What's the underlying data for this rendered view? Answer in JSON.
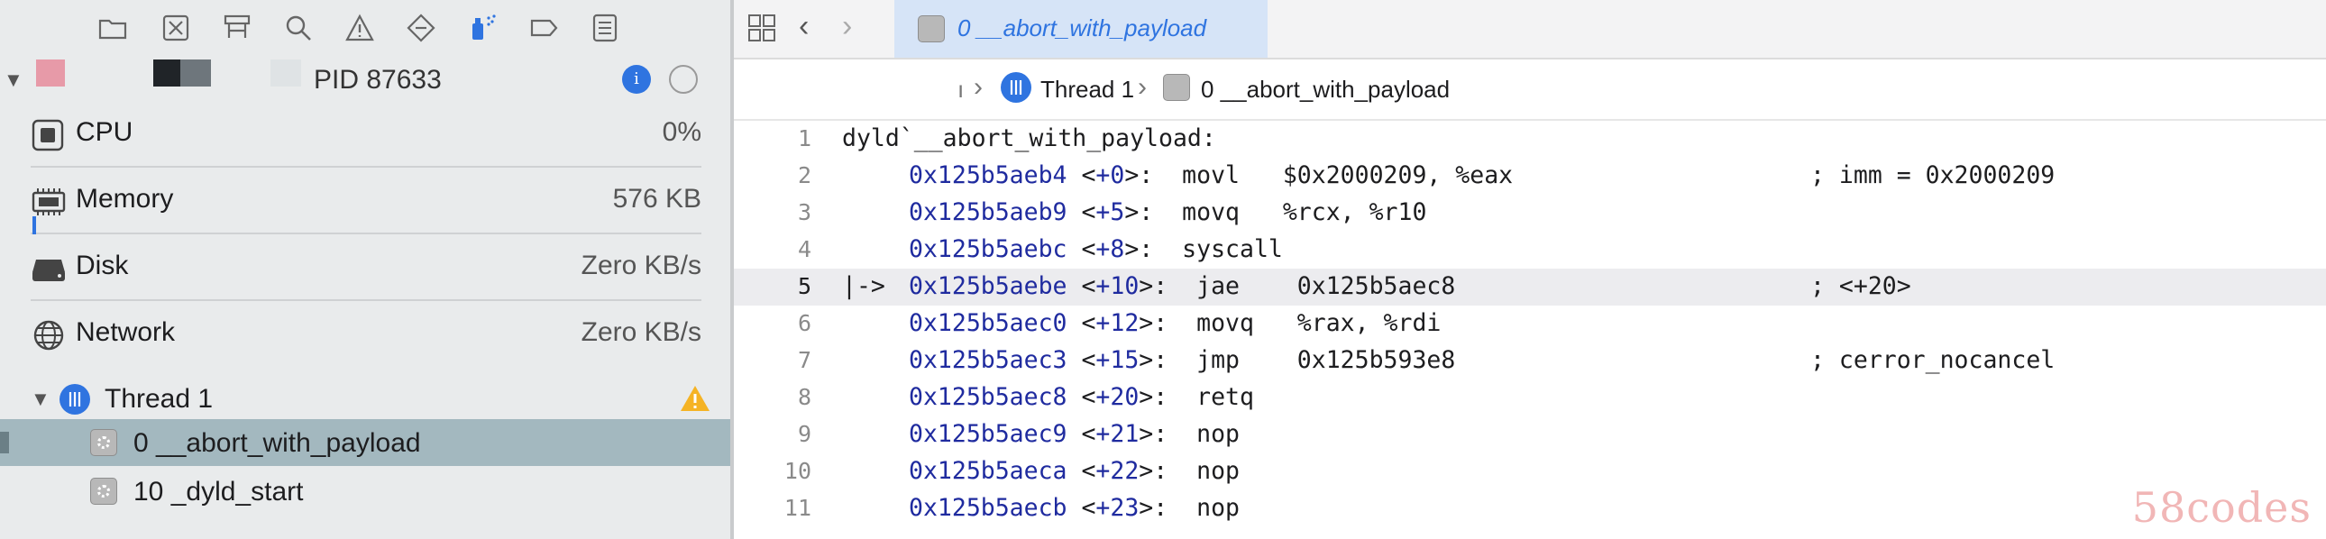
{
  "navigator": {
    "process": {
      "pid_label": "PID 87633"
    },
    "gauges": [
      {
        "name": "CPU",
        "value": "0%"
      },
      {
        "name": "Memory",
        "value": "576 KB"
      },
      {
        "name": "Disk",
        "value": "Zero KB/s"
      },
      {
        "name": "Network",
        "value": "Zero KB/s"
      }
    ],
    "thread": {
      "label": "Thread 1"
    },
    "frames": [
      {
        "label": "0 __abort_with_payload",
        "selected": true
      },
      {
        "label": "10 _dyld_start",
        "selected": false
      }
    ]
  },
  "editor": {
    "tab": {
      "title": "0 __abort_with_payload"
    },
    "jumpbar": {
      "thread": "Thread 1",
      "frame": "0 __abort_with_payload"
    },
    "code": {
      "header": "dyld`__abort_with_payload:",
      "lines": [
        {
          "n": "1"
        },
        {
          "n": "2",
          "addr": "0x125b5aeb4",
          "off": "+0",
          "instr": "movl   $0x2000209, %eax",
          "comment": "; imm = 0x2000209"
        },
        {
          "n": "3",
          "addr": "0x125b5aeb9",
          "off": "+5",
          "instr": "movq   %rcx, %r10",
          "comment": ""
        },
        {
          "n": "4",
          "addr": "0x125b5aebc",
          "off": "+8",
          "instr": "syscall",
          "comment": ""
        },
        {
          "n": "5",
          "addr": "0x125b5aebe",
          "off": "+10",
          "instr": "jae    0x125b5aec8",
          "comment": "; <+20>",
          "current": true
        },
        {
          "n": "6",
          "addr": "0x125b5aec0",
          "off": "+12",
          "instr": "movq   %rax, %rdi",
          "comment": ""
        },
        {
          "n": "7",
          "addr": "0x125b5aec3",
          "off": "+15",
          "instr": "jmp    0x125b593e8",
          "comment": "; cerror_nocancel"
        },
        {
          "n": "8",
          "addr": "0x125b5aec8",
          "off": "+20",
          "instr": "retq",
          "comment": ""
        },
        {
          "n": "9",
          "addr": "0x125b5aec9",
          "off": "+21",
          "instr": "nop",
          "comment": ""
        },
        {
          "n": "10",
          "addr": "0x125b5aeca",
          "off": "+22",
          "instr": "nop",
          "comment": ""
        },
        {
          "n": "11",
          "addr": "0x125b5aecb",
          "off": "+23",
          "instr": "nop",
          "comment": ""
        }
      ]
    }
  },
  "watermark": "58codes",
  "colors": {
    "accent": "#2f74e0",
    "selection": "#a3b8bf",
    "address": "#1f2b9f"
  }
}
